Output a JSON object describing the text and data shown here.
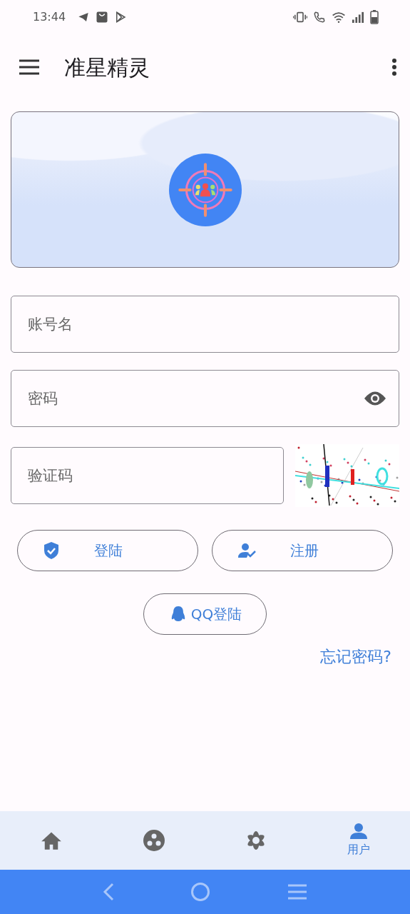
{
  "status_bar": {
    "time": "13:44"
  },
  "app_bar": {
    "title": "准星精灵"
  },
  "fields": [
    {
      "kind": "text",
      "placeholder": "账号名"
    },
    {
      "kind": "password",
      "placeholder": "密码"
    },
    {
      "kind": "captcha",
      "placeholder": "验证码"
    }
  ],
  "buttons": [
    {
      "kind": "login",
      "label": "登陆"
    },
    {
      "kind": "register",
      "label": "注册"
    }
  ],
  "qq_button": {
    "label": "QQ登陆"
  },
  "forgot_link": "忘记密码?",
  "bottom_nav": [
    {
      "kind": "home",
      "selected": false
    },
    {
      "kind": "community",
      "selected": false
    },
    {
      "kind": "flower",
      "selected": false
    },
    {
      "kind": "user",
      "selected": true,
      "label": "用户"
    }
  ]
}
